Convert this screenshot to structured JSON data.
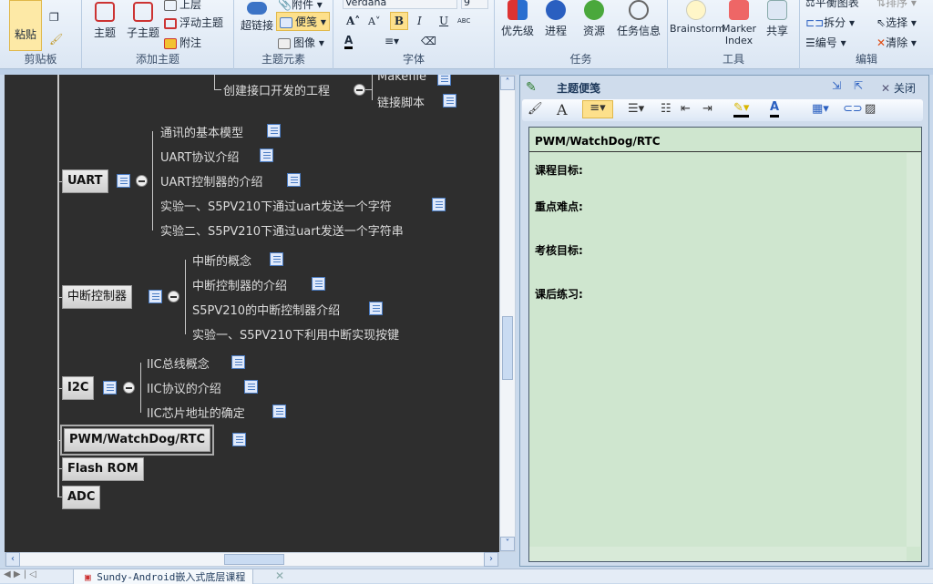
{
  "ribbon": {
    "clipboard": {
      "label": "剪贴板",
      "paste": "粘贴"
    },
    "add_topic": {
      "label": "添加主题",
      "topic": "主题",
      "subtopic": "子主题",
      "parent": "上层",
      "floating": "浮动主题",
      "callout": "附注"
    },
    "topic_elements": {
      "label": "主题元素",
      "hyperlink": "超链接",
      "attachment": "附件",
      "notes": "便笺",
      "image": "图像"
    },
    "font": {
      "label": "字体",
      "family": "Verdana",
      "size": "9",
      "bold": "B",
      "italic": "I",
      "underline": "U",
      "strike": "ABC"
    },
    "task": {
      "label": "任务",
      "priority": "优先级",
      "progress": "进程",
      "resource": "资源",
      "task_info": "任务信息"
    },
    "tools": {
      "label": "工具",
      "brainstorm": "Brainstorm",
      "marker_index": "Marker Index",
      "share": "共享"
    },
    "edit": {
      "label": "编辑",
      "balance": "平衡图表",
      "sort": "排序",
      "split": "拆分",
      "select": "选择",
      "numbering": "编号",
      "clear": "清除"
    }
  },
  "mindmap": {
    "top": {
      "parent": "创建接口开发的工程",
      "children": [
        "Makefile",
        "链接脚本"
      ]
    },
    "topics": [
      {
        "label": "UART",
        "children": [
          "通讯的基本模型",
          "UART协议介绍",
          "UART控制器的介绍",
          "实验一、S5PV210下通过uart发送一个字符",
          "实验二、S5PV210下通过uart发送一个字符串"
        ]
      },
      {
        "label": "中断控制器",
        "children": [
          "中断的概念",
          "中断控制器的介绍",
          "S5PV210的中断控制器介绍",
          "实验一、S5PV210下利用中断实现按键"
        ]
      },
      {
        "label": "I2C",
        "children": [
          "IIC总线概念",
          "IIC协议的介绍",
          "IIC芯片地址的确定"
        ]
      },
      {
        "label": "PWM/WatchDog/RTC",
        "selected": true
      },
      {
        "label": "Flash ROM"
      },
      {
        "label": "ADC"
      }
    ]
  },
  "notes_pane": {
    "title": "主题便笺",
    "close": "关闭",
    "topic": "PWM/WatchDog/RTC",
    "fields": [
      "课程目标:",
      "重点难点:",
      "考核目标:",
      "课后练习:"
    ]
  },
  "tabs": [
    {
      "label": "Sundy-Android嵌入式底层课程"
    }
  ],
  "colors": {
    "canvas": "#2e2e2e",
    "note_bg": "#cfe6cf",
    "ribbon": "#dbe6f3"
  }
}
